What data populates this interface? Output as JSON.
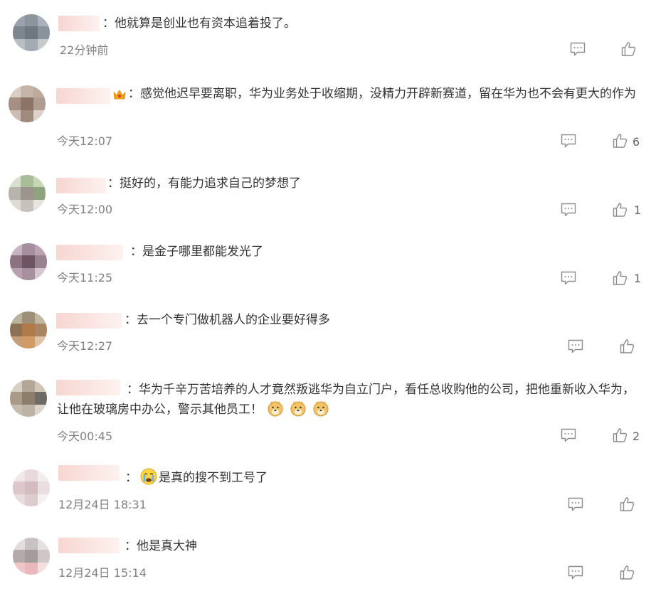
{
  "comments": [
    {
      "text": "：他就算是创业也有资本追着投了。",
      "time": "22分钟前",
      "likes": ""
    },
    {
      "text": "：感觉他迟早要离职，华为业务处于收缩期，没精力开辟新赛道，留在华为也不会有更大的作为",
      "time": "今天12:07",
      "likes": "6"
    },
    {
      "text": "：挺好的，有能力追求自己的梦想了",
      "time": "今天12:00",
      "likes": "1"
    },
    {
      "text": "：是金子哪里都能发光了",
      "time": "今天11:25",
      "likes": "1"
    },
    {
      "text": "：去一个专门做机器人的企业要好得多",
      "time": "今天12:27",
      "likes": ""
    },
    {
      "text": "：华为千辛万苦培养的人才竟然叛逃华为自立门户，看任总收购他的公司，把他重新收入华为，让他在玻璃房中办公，警示其他员工！",
      "time": "今天00:45",
      "likes": "2"
    },
    {
      "text_colon": "：",
      "text": "是真的搜不到工号了",
      "time": "12月24日 18:31",
      "likes": ""
    },
    {
      "text": "：他是真大神",
      "time": "12月24日 15:14",
      "likes": ""
    }
  ],
  "icons": {
    "reply": "comment-icon",
    "like": "thumbs-up-icon",
    "doge": "doge-emoji-icon",
    "cry": "crying-emoji-icon",
    "crown": "crown-badge-icon"
  },
  "colors": {
    "text": "#333333",
    "time": "#808080",
    "icon": "#8c8c8c",
    "name_blur": "#f7d6d1"
  }
}
